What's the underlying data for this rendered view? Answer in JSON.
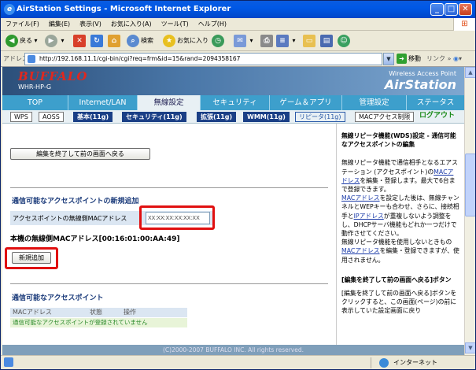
{
  "window": {
    "title": "AirStation Settings - Microsoft Internet Explorer"
  },
  "menu": [
    "ファイル(F)",
    "編集(E)",
    "表示(V)",
    "お気に入り(A)",
    "ツール(T)",
    "ヘルプ(H)"
  ],
  "toolbar": {
    "back": "戻る",
    "search": "検索",
    "favorites": "お気に入り"
  },
  "address": {
    "label": "アドレス(D)",
    "url": "http://192.168.11.1/cgi-bin/cgi?req=frm&id=15&rand=2094358167",
    "go": "移動",
    "links": "リンク"
  },
  "header": {
    "brand": "BUFFALO",
    "model": "WHR-HP-G",
    "product_sub": "Wireless Access Point",
    "product_name": "AirStation"
  },
  "main_tabs": [
    "TOP",
    "Internet/LAN",
    "無線設定",
    "セキュリティ",
    "ゲーム＆アプリ",
    "管理設定",
    "ステータス"
  ],
  "sub_tabs": [
    "WPS",
    "AOSS",
    "基本(11g)",
    "セキュリティ(11g)",
    "拡張(11g)",
    "WMM(11g)",
    "リピータ(11g)",
    "MACアクセス制限",
    "ログアウト"
  ],
  "left": {
    "back_button": "編集を終了して前の画面へ戻る",
    "new_section_title": "通信可能なアクセスポイントの新規追加",
    "mac_label": "アクセスポイントの無線側MACアドレス",
    "mac_value": "XX:XX:XX:XX:XX:XX",
    "own_mac": "本機の無線側MACアドレス[00:16:01:00:AA:49]",
    "add_button": "新規追加",
    "list_title": "通信可能なアクセスポイント",
    "col_mac": "MACアドレス",
    "col_status": "状態",
    "col_op": "操作",
    "empty": "通信可能なアクセスポイントが登録されていません"
  },
  "help": {
    "title": "無線リピータ機能(WDS)設定 - 通信可能なアクセスポイントの編集",
    "p1a": "無線リピータ機能で通信相手となるエアステーション (アクセスポイント)の",
    "link_mac": "MACアドレス",
    "p1b": "を編集・登録します。最大で6台まで登録できます。",
    "p2b": "を設定した後は、無線チャンネルとWEPキーも合わせ、さらに、接続相手と",
    "link_ip": "IPアドレス",
    "p2c": "が重複しないよう調整をし、DHCPサーバ機能もどれか一つだけで動作させてください。",
    "p3a": "無線リピータ機能を使用しないときもの",
    "p3b": "を編集・登録できますが、使用されません。",
    "title2": "[編集を終了して前の画面へ戻る]ボタン",
    "p4": "[編集を終了して前の画面へ戻る]ボタンをクリックすると、この画面(ページ)の前に表示していた設定画面に戻り"
  },
  "footer": "(C)2000-2007 BUFFALO INC. All rights reserved.",
  "status": {
    "zone": "インターネット"
  }
}
